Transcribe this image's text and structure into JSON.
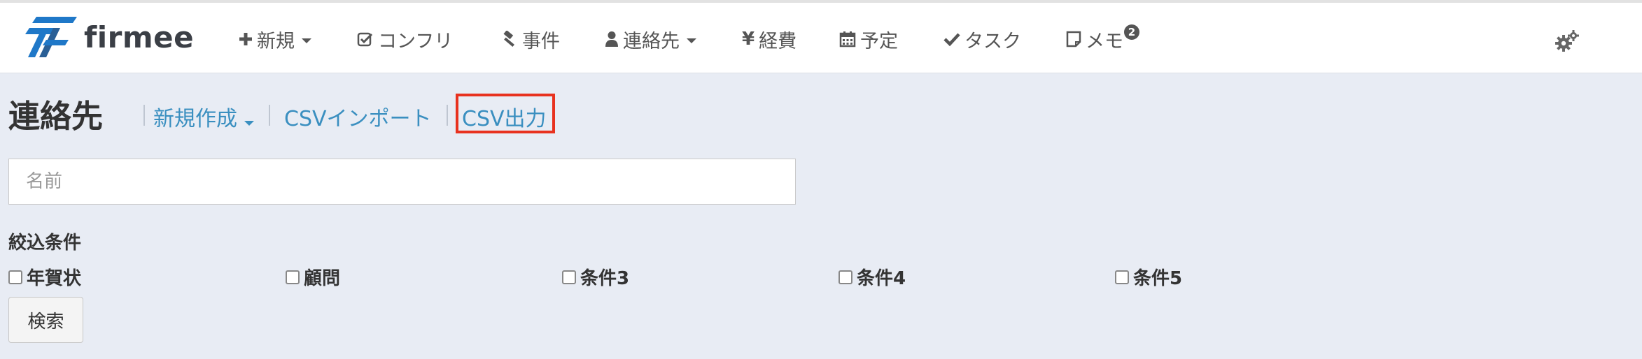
{
  "brand": {
    "name": "firmee"
  },
  "nav": {
    "items": [
      {
        "key": "new",
        "label": "新規",
        "icon": "plus-icon",
        "dropdown": true
      },
      {
        "key": "conflict",
        "label": "コンフリ",
        "icon": "checkbox-icon",
        "dropdown": false
      },
      {
        "key": "cases",
        "label": "事件",
        "icon": "gavel-icon",
        "dropdown": false
      },
      {
        "key": "contacts",
        "label": "連絡先",
        "icon": "user-icon",
        "dropdown": true
      },
      {
        "key": "expenses",
        "label": "経費",
        "icon": "yen-icon",
        "dropdown": false
      },
      {
        "key": "schedule",
        "label": "予定",
        "icon": "calendar-icon",
        "dropdown": false
      },
      {
        "key": "tasks",
        "label": "タスク",
        "icon": "check-icon",
        "dropdown": false
      },
      {
        "key": "memo",
        "label": "メモ",
        "icon": "note-icon",
        "dropdown": false,
        "badge": "2"
      }
    ]
  },
  "header": {
    "title": "連絡先",
    "links": {
      "new_label": "新規作成",
      "import_label": "CSVインポート",
      "export_label": "CSV出力"
    }
  },
  "search": {
    "placeholder": "名前",
    "value": "",
    "filter_label": "絞込条件",
    "filters": [
      {
        "label": "年賀状",
        "checked": false
      },
      {
        "label": "顧問",
        "checked": false
      },
      {
        "label": "条件3",
        "checked": false
      },
      {
        "label": "条件4",
        "checked": false
      },
      {
        "label": "条件5",
        "checked": false
      }
    ],
    "submit_label": "検索"
  },
  "colors": {
    "accent_link": "#3a8fc0",
    "highlight": "#e8321f",
    "background": "#e8ecf4",
    "logo_blue": "#1f78c8"
  }
}
